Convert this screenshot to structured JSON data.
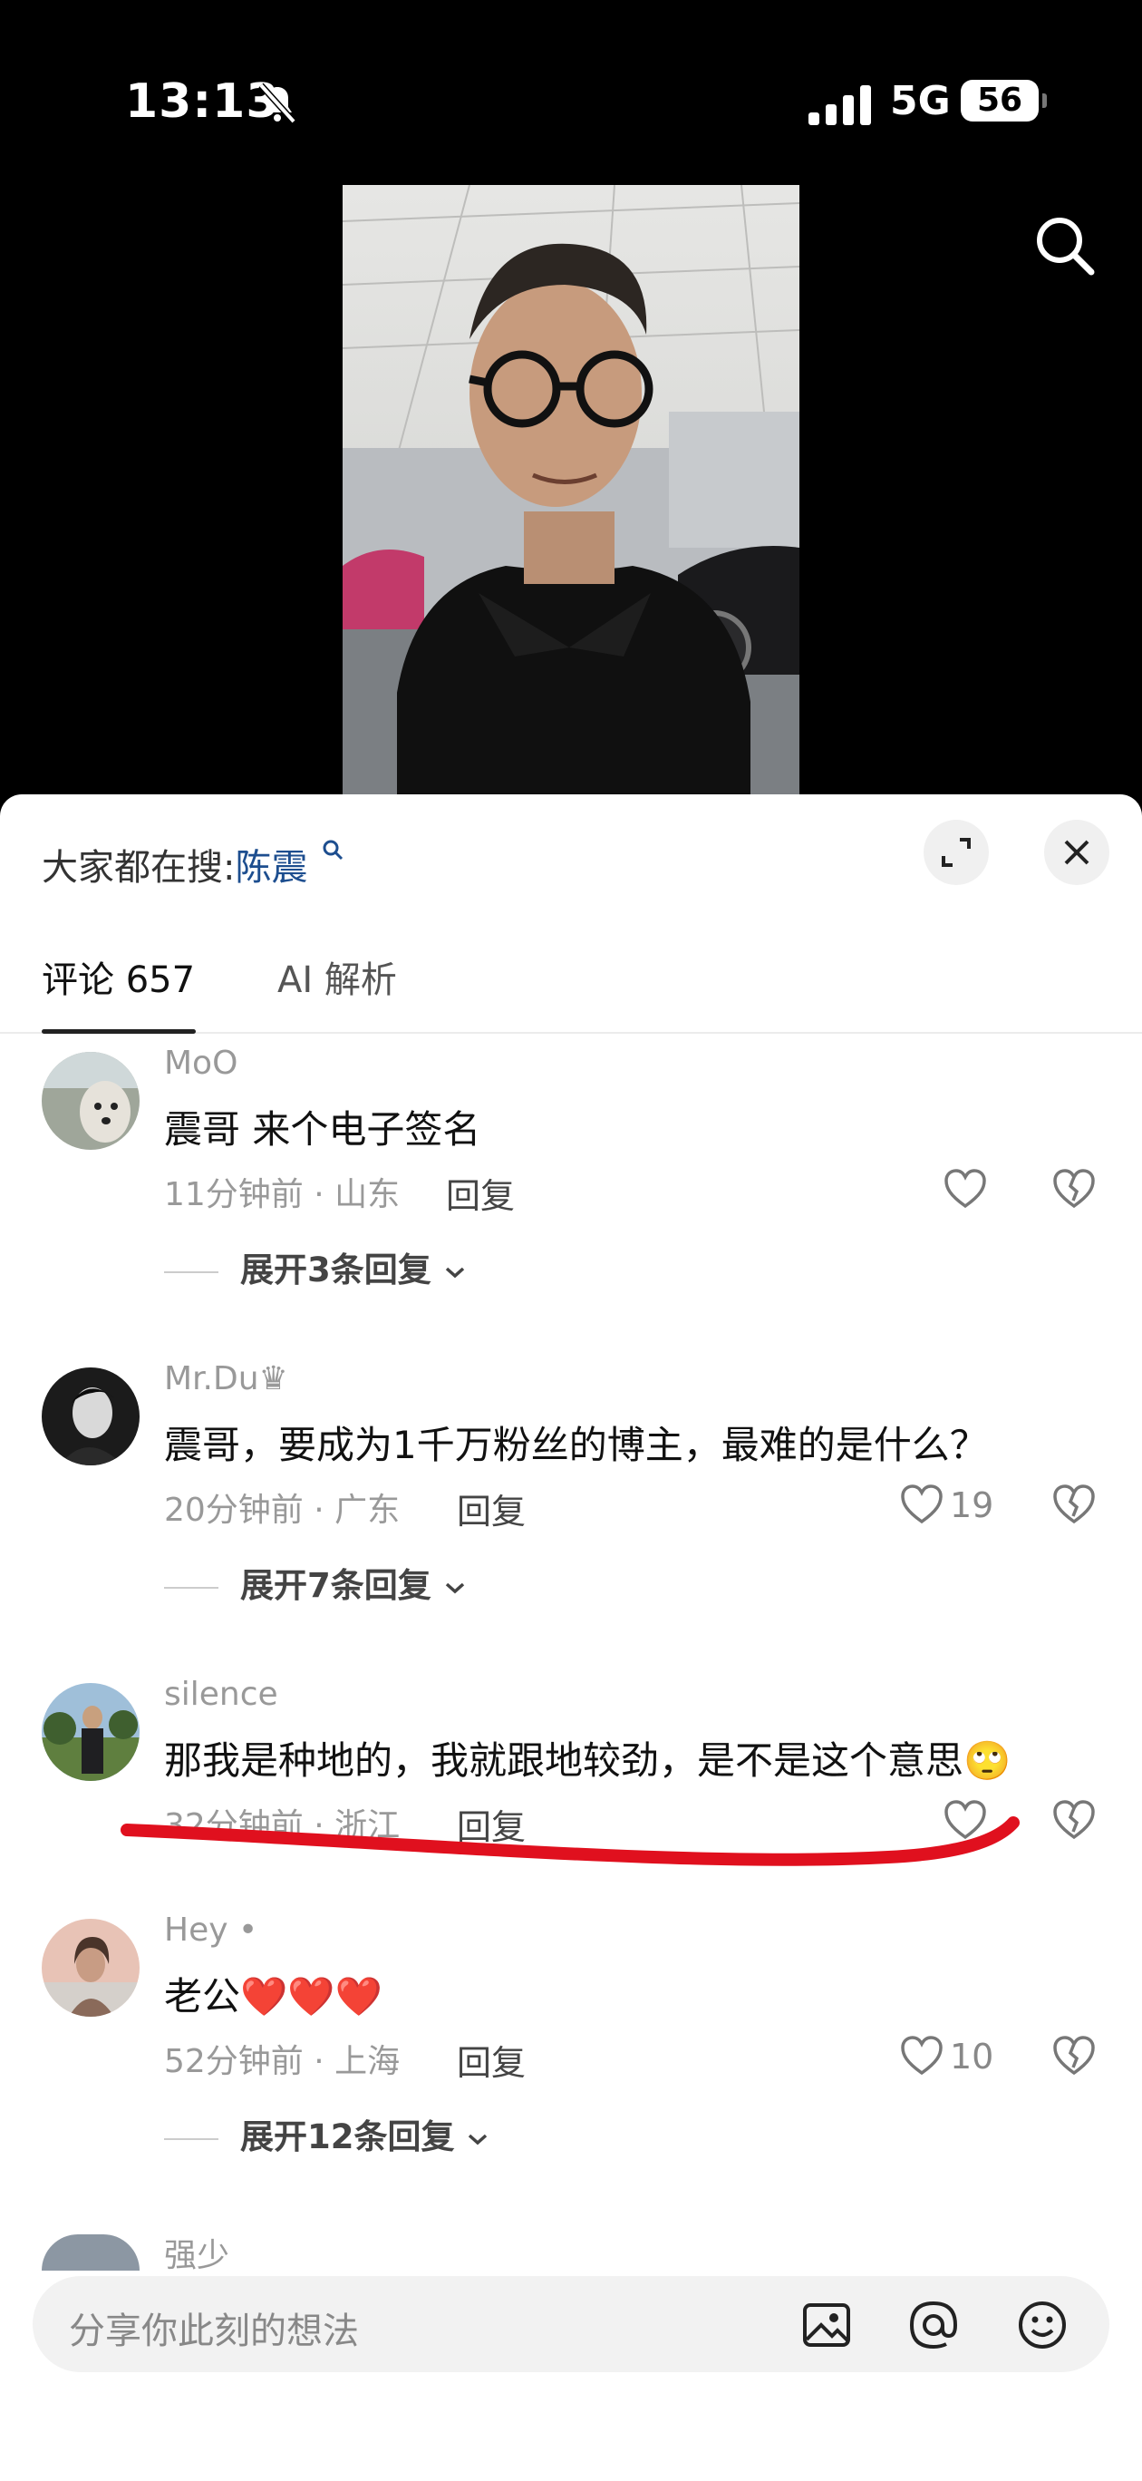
{
  "status_bar": {
    "time": "13:13",
    "network": "5G",
    "battery": "56"
  },
  "panel": {
    "trend_prefix": "大家都在搜:",
    "trend_keyword": "陈震",
    "tabs": [
      {
        "label": "评论 657"
      },
      {
        "label": "AI 解析"
      }
    ]
  },
  "comments": [
    {
      "user": "MoO",
      "text": "震哥 来个电子签名",
      "meta": "11分钟前 · 山东",
      "reply": "回复",
      "likes": "",
      "expand": "展开3条回复"
    },
    {
      "user": "Mr.Du♛",
      "text": "震哥，要成为1千万粉丝的博主，最难的是什么？",
      "meta": "20分钟前 · 广东",
      "reply": "回复",
      "likes": "19",
      "expand": "展开7条回复"
    },
    {
      "user": "silence",
      "text": "那我是种地的，我就跟地较劲，是不是这个意思🙄",
      "meta": "32分钟前 · 浙江",
      "reply": "回复",
      "likes": "",
      "expand": ""
    },
    {
      "user": "Hey •",
      "text": "老公❤️❤️❤️",
      "meta": "52分钟前 · 上海",
      "reply": "回复",
      "likes": "10",
      "expand": "展开12条回复"
    },
    {
      "user": "强少"
    }
  ],
  "composer": {
    "placeholder": "分享你此刻的想法"
  },
  "icons": [
    "bell-slash-icon",
    "signal-icon",
    "search-icon",
    "expand-icon",
    "close-icon",
    "heart-icon",
    "broken-heart-icon",
    "chevron-down-icon",
    "image-icon",
    "at-icon",
    "emoji-icon"
  ],
  "colors": {
    "accent_link": "#1d4e8f",
    "annotation_red": "#e0101e",
    "heart_red": "#e8202c"
  }
}
